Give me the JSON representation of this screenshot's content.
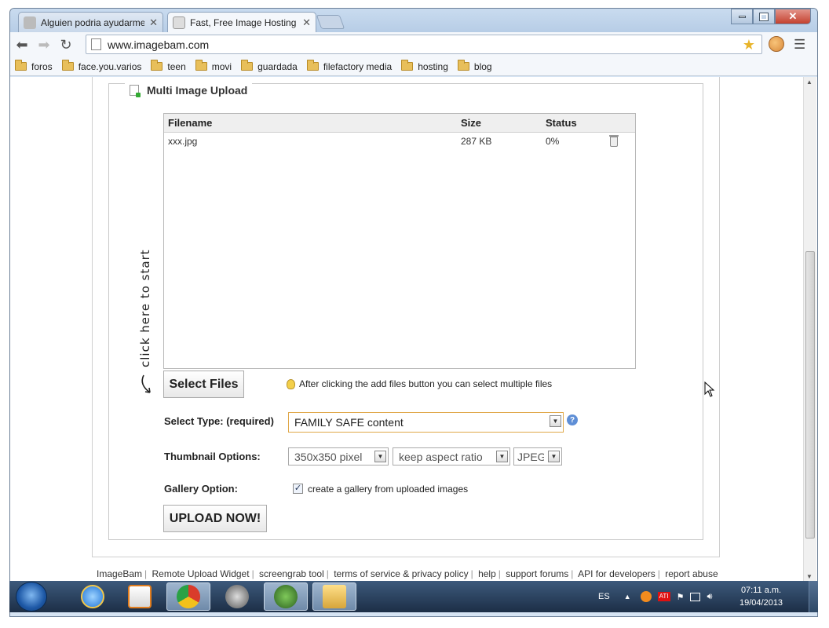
{
  "browser": {
    "tabs": [
      {
        "title": "Alguien podria ayudarme",
        "favicon": "alien-favicon-icon"
      },
      {
        "title": "Fast, Free Image Hosting -",
        "favicon": "page-favicon-icon"
      }
    ],
    "url": "www.imagebam.com",
    "bookmarks": [
      "foros",
      "face.you.varios",
      "teen",
      "movi",
      "guardada",
      "filefactory media",
      "hosting",
      "blog"
    ]
  },
  "upload": {
    "legend": "Multi Image Upload",
    "columns": {
      "filename": "Filename",
      "size": "Size",
      "status": "Status"
    },
    "files": [
      {
        "filename": "xxx.jpg",
        "size": "287 KB",
        "status": "0%"
      }
    ],
    "hint_text": "click here to start",
    "select_files_label": "Select Files",
    "tip": "After clicking the add files button you can select multiple files",
    "type_label": "Select Type: (required)",
    "type_value": "FAMILY SAFE content",
    "thumb_label": "Thumbnail Options:",
    "thumb_size": "350x350 pixel",
    "thumb_ratio": "keep aspect ratio",
    "thumb_format": "JPEG",
    "gallery_label": "Gallery Option:",
    "gallery_checked": true,
    "gallery_text": "create a gallery from uploaded images",
    "upload_label": "UPLOAD NOW!"
  },
  "footer": [
    "ImageBam",
    "Remote Upload Widget",
    "screengrab tool",
    "terms of service & privacy policy",
    "help",
    "support forums",
    "API for developers",
    "report abuse"
  ],
  "taskbar": {
    "language": "ES",
    "time": "07:11 a.m.",
    "date": "19/04/2013"
  },
  "colors": {
    "accent_select_border": "#e0a84a",
    "taskbar": "#1c2e46"
  }
}
